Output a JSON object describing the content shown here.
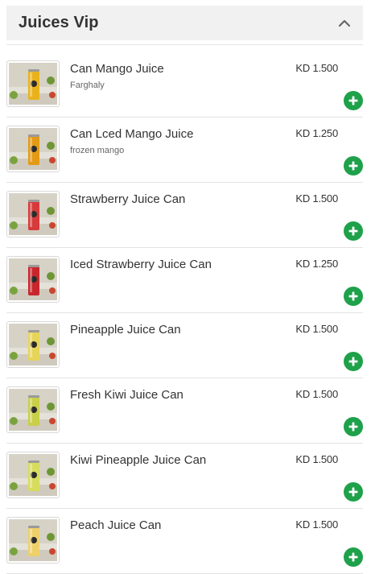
{
  "section": {
    "title": "Juices Vip",
    "toggle_icon": "chevron-up-icon"
  },
  "colors": {
    "accent": "#1ea14a",
    "header_bg": "#f1f1f1",
    "divider": "#e3e3e3"
  },
  "items": [
    {
      "name": "Can Mango Juice",
      "description": "Farghaly",
      "price": "KD 1.500",
      "can_color": "#e9b21c"
    },
    {
      "name": "Can Lced Mango Juice",
      "description": "frozen mango",
      "price": "KD 1.250",
      "can_color": "#e39a14"
    },
    {
      "name": "Strawberry Juice Can",
      "description": "",
      "price": "KD 1.500",
      "can_color": "#d63a3a"
    },
    {
      "name": "Iced Strawberry Juice Can",
      "description": "",
      "price": "KD 1.250",
      "can_color": "#c8262c"
    },
    {
      "name": "Pineapple Juice Can",
      "description": "",
      "price": "KD 1.500",
      "can_color": "#e7d55a"
    },
    {
      "name": "Fresh Kiwi Juice Can",
      "description": "",
      "price": "KD 1.500",
      "can_color": "#c9cf48"
    },
    {
      "name": "Kiwi Pineapple Juice Can",
      "description": "",
      "price": "KD 1.500",
      "can_color": "#d7dc5c"
    },
    {
      "name": "Peach Juice Can",
      "description": "",
      "price": "KD 1.500",
      "can_color": "#eed06a"
    }
  ],
  "add_icon": "plus-circle-icon"
}
